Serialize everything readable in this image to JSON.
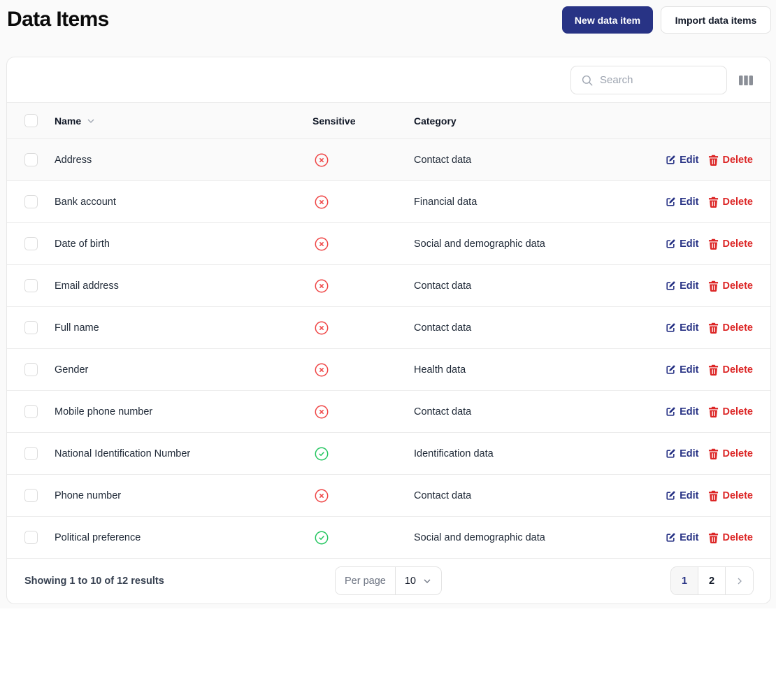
{
  "header": {
    "title": "Data Items",
    "new_button": "New data item",
    "import_button": "Import data items"
  },
  "toolbar": {
    "search_placeholder": "Search",
    "search_value": ""
  },
  "table": {
    "columns": {
      "name": "Name",
      "sensitive": "Sensitive",
      "category": "Category"
    },
    "sort": {
      "column": "name",
      "direction": "desc-indicator"
    },
    "action_labels": {
      "edit": "Edit",
      "delete": "Delete"
    },
    "rows": [
      {
        "name": "Address",
        "sensitive": false,
        "category": "Contact data"
      },
      {
        "name": "Bank account",
        "sensitive": false,
        "category": "Financial data"
      },
      {
        "name": "Date of birth",
        "sensitive": false,
        "category": "Social and demographic data"
      },
      {
        "name": "Email address",
        "sensitive": false,
        "category": "Contact data"
      },
      {
        "name": "Full name",
        "sensitive": false,
        "category": "Contact data"
      },
      {
        "name": "Gender",
        "sensitive": false,
        "category": "Health data"
      },
      {
        "name": "Mobile phone number",
        "sensitive": false,
        "category": "Contact data"
      },
      {
        "name": "National Identification Number",
        "sensitive": true,
        "category": "Identification data"
      },
      {
        "name": "Phone number",
        "sensitive": false,
        "category": "Contact data"
      },
      {
        "name": "Political preference",
        "sensitive": true,
        "category": "Social and demographic data"
      }
    ],
    "hovered_row": 0
  },
  "footer": {
    "results_text": "Showing 1 to 10 of 12 results",
    "per_page_label": "Per page",
    "per_page_value": "10",
    "pages": [
      "1",
      "2"
    ],
    "current_page": "1"
  },
  "colors": {
    "primary": "#283385",
    "danger": "#dc2626",
    "success": "#22c55e",
    "error_icon": "#ef4444"
  },
  "icons": {
    "search": "search-icon",
    "columns": "columns-icon",
    "sort": "chevron-down-icon",
    "sensitive_true": "check-circle-icon",
    "sensitive_false": "x-circle-icon",
    "edit": "pencil-square-icon",
    "delete": "trash-icon",
    "per_page": "chevron-down-icon",
    "next": "chevron-right-icon"
  }
}
